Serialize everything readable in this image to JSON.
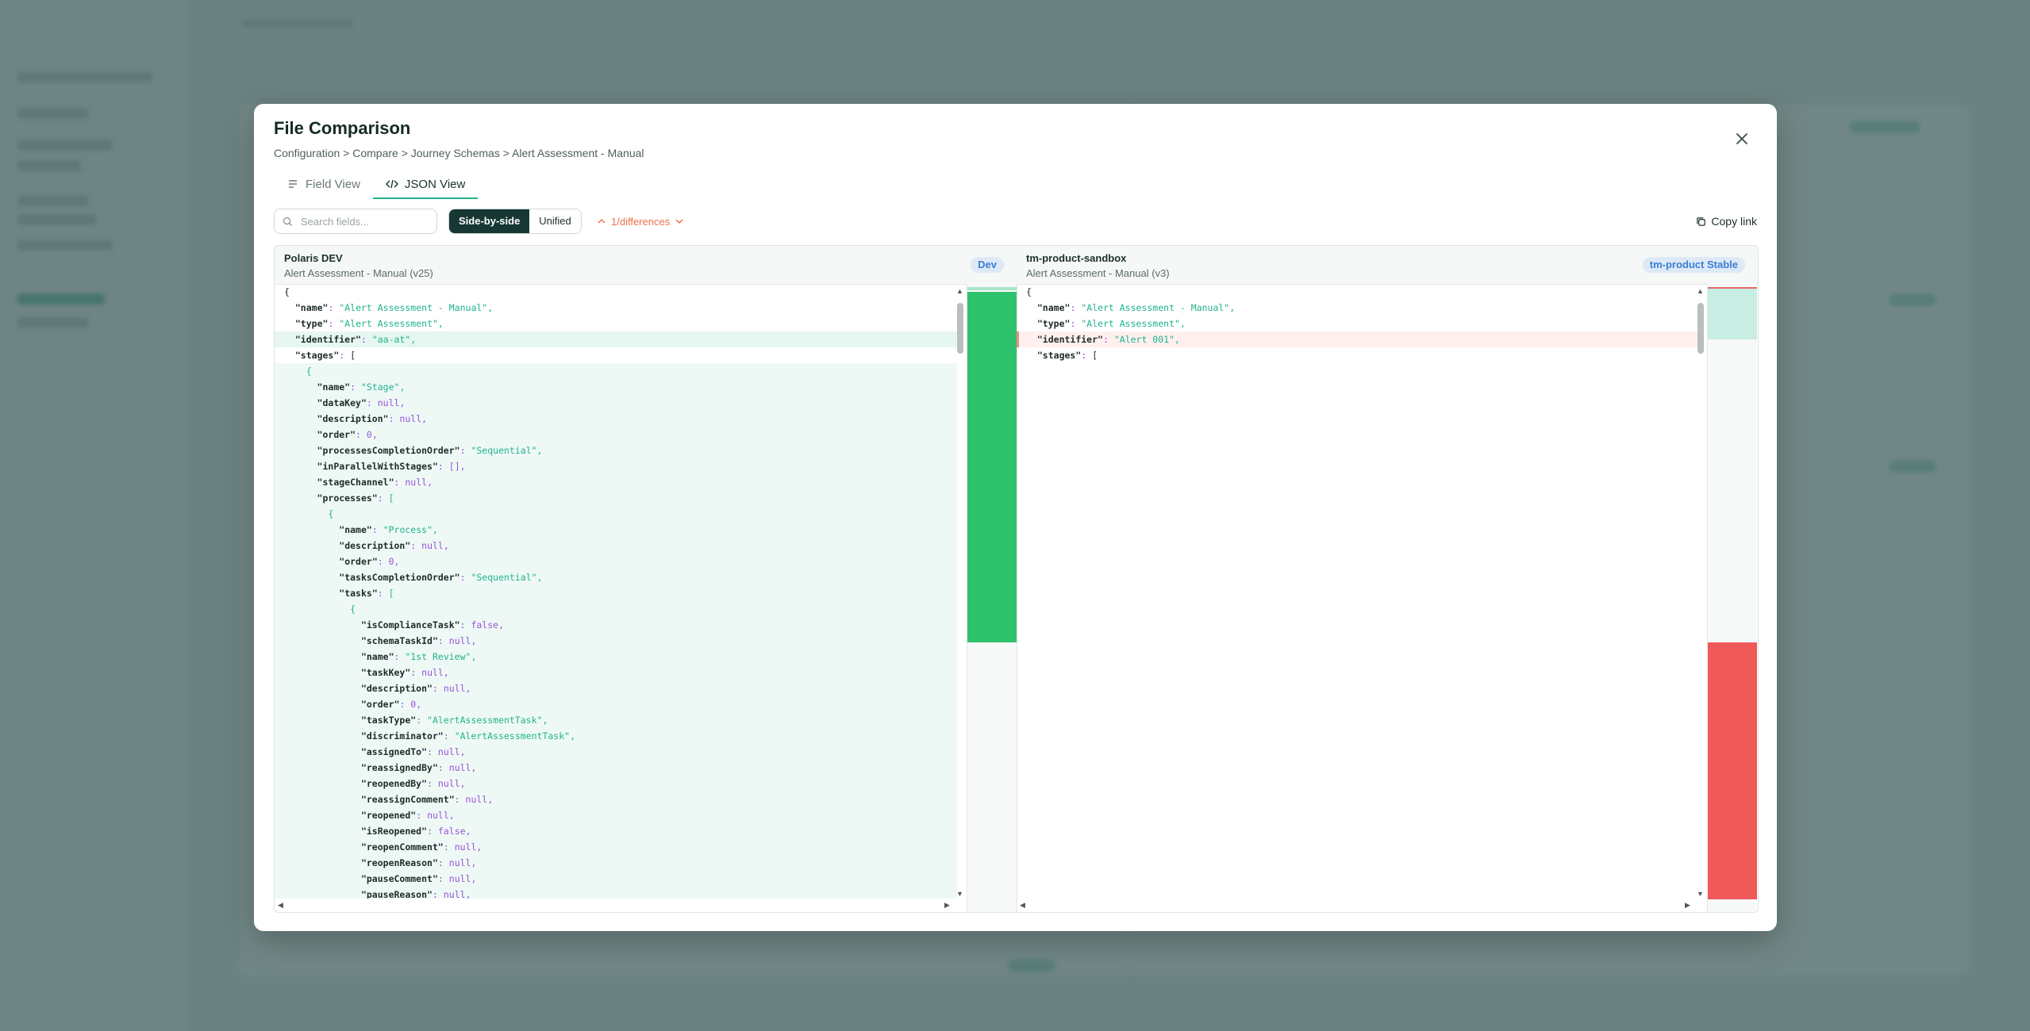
{
  "modal": {
    "title": "File Comparison",
    "breadcrumb": "Configuration > Compare > Journey Schemas > Alert Assessment - Manual",
    "tabs": [
      {
        "label": "Field View",
        "icon": "list-icon",
        "active": false
      },
      {
        "label": "JSON View",
        "icon": "code-icon",
        "active": true
      }
    ]
  },
  "toolbar": {
    "search_placeholder": "Search fields...",
    "view_modes": [
      "Side-by-side",
      "Unified"
    ],
    "active_view_mode": "Side-by-side",
    "differences_label": "1/differences",
    "copy_link_label": "Copy link"
  },
  "left_panel": {
    "env_name": "Polaris DEV",
    "schema_name": "Alert Assessment - Manual (v25)",
    "badge": "Dev"
  },
  "right_panel": {
    "env_name": "tm-product-sandbox",
    "schema_name": "Alert Assessment - Manual (v3)",
    "badge": "tm-product Stable"
  },
  "left_lines": [
    {
      "indent": 0,
      "text": "{",
      "status": "normal"
    },
    {
      "indent": 1,
      "key": "name",
      "value": "\"Alert Assessment - Manual\"",
      "vtype": "s",
      "status": "normal"
    },
    {
      "indent": 1,
      "key": "type",
      "value": "\"Alert Assessment\"",
      "vtype": "s",
      "status": "normal"
    },
    {
      "indent": 1,
      "key": "identifier",
      "value": "\"aa-at\"",
      "vtype": "s",
      "status": "changed"
    },
    {
      "indent": 1,
      "key": "stages",
      "value": "[",
      "vtype": "p",
      "status": "normal"
    },
    {
      "indent": 2,
      "text": "{",
      "status": "added"
    },
    {
      "indent": 3,
      "key": "name",
      "value": "\"Stage\"",
      "vtype": "s",
      "status": "added"
    },
    {
      "indent": 3,
      "key": "dataKey",
      "value": "null",
      "vtype": "n",
      "status": "added"
    },
    {
      "indent": 3,
      "key": "description",
      "value": "null",
      "vtype": "n",
      "status": "added"
    },
    {
      "indent": 3,
      "key": "order",
      "value": "0",
      "vtype": "n",
      "status": "added"
    },
    {
      "indent": 3,
      "key": "processesCompletionOrder",
      "value": "\"Sequential\"",
      "vtype": "s",
      "status": "added"
    },
    {
      "indent": 3,
      "key": "inParallelWithStages",
      "value": "[]",
      "vtype": "n",
      "status": "added"
    },
    {
      "indent": 3,
      "key": "stageChannel",
      "value": "null",
      "vtype": "n",
      "status": "added"
    },
    {
      "indent": 3,
      "key": "processes",
      "value": "[",
      "vtype": "s",
      "status": "added"
    },
    {
      "indent": 4,
      "text": "{",
      "status": "added"
    },
    {
      "indent": 5,
      "key": "name",
      "value": "\"Process\"",
      "vtype": "s",
      "status": "added"
    },
    {
      "indent": 5,
      "key": "description",
      "value": "null",
      "vtype": "n",
      "status": "added"
    },
    {
      "indent": 5,
      "key": "order",
      "value": "0",
      "vtype": "n",
      "status": "added"
    },
    {
      "indent": 5,
      "key": "tasksCompletionOrder",
      "value": "\"Sequential\"",
      "vtype": "s",
      "status": "added"
    },
    {
      "indent": 5,
      "key": "tasks",
      "value": "[",
      "vtype": "s",
      "status": "added"
    },
    {
      "indent": 6,
      "text": "{",
      "status": "added"
    },
    {
      "indent": 7,
      "key": "isComplianceTask",
      "value": "false",
      "vtype": "n",
      "status": "added"
    },
    {
      "indent": 7,
      "key": "schemaTaskId",
      "value": "null",
      "vtype": "n",
      "status": "added"
    },
    {
      "indent": 7,
      "key": "name",
      "value": "\"1st Review\"",
      "vtype": "s",
      "status": "added"
    },
    {
      "indent": 7,
      "key": "taskKey",
      "value": "null",
      "vtype": "n",
      "status": "added"
    },
    {
      "indent": 7,
      "key": "description",
      "value": "null",
      "vtype": "n",
      "status": "added"
    },
    {
      "indent": 7,
      "key": "order",
      "value": "0",
      "vtype": "n",
      "status": "added"
    },
    {
      "indent": 7,
      "key": "taskType",
      "value": "\"AlertAssessmentTask\"",
      "vtype": "s",
      "status": "added"
    },
    {
      "indent": 7,
      "key": "discriminator",
      "value": "\"AlertAssessmentTask\"",
      "vtype": "s",
      "status": "added"
    },
    {
      "indent": 7,
      "key": "assignedTo",
      "value": "null",
      "vtype": "n",
      "status": "added"
    },
    {
      "indent": 7,
      "key": "reassignedBy",
      "value": "null",
      "vtype": "n",
      "status": "added"
    },
    {
      "indent": 7,
      "key": "reopenedBy",
      "value": "null",
      "vtype": "n",
      "status": "added"
    },
    {
      "indent": 7,
      "key": "reassignComment",
      "value": "null",
      "vtype": "n",
      "status": "added"
    },
    {
      "indent": 7,
      "key": "reopened",
      "value": "null",
      "vtype": "n",
      "status": "added"
    },
    {
      "indent": 7,
      "key": "isReopened",
      "value": "false",
      "vtype": "n",
      "status": "added"
    },
    {
      "indent": 7,
      "key": "reopenComment",
      "value": "null",
      "vtype": "n",
      "status": "added"
    },
    {
      "indent": 7,
      "key": "reopenReason",
      "value": "null",
      "vtype": "n",
      "status": "added"
    },
    {
      "indent": 7,
      "key": "pauseComment",
      "value": "null",
      "vtype": "n",
      "status": "added"
    },
    {
      "indent": 7,
      "key": "pauseReason",
      "value": "null",
      "vtype": "n",
      "status": "added"
    }
  ],
  "right_lines": [
    {
      "indent": 0,
      "text": "{",
      "status": "normal"
    },
    {
      "indent": 1,
      "key": "name",
      "value": "\"Alert Assessment - Manual\"",
      "vtype": "s",
      "status": "normal"
    },
    {
      "indent": 1,
      "key": "type",
      "value": "\"Alert Assessment\"",
      "vtype": "s",
      "status": "normal"
    },
    {
      "indent": 1,
      "key": "identifier",
      "value": "\"Alert 001\"",
      "vtype": "s",
      "status": "removed"
    },
    {
      "indent": 1,
      "key": "stages",
      "value": "[",
      "vtype": "p",
      "status": "normal"
    }
  ],
  "colors": {
    "accent": "#2ab08c",
    "added_minimap": "#2ec26e",
    "removed_minimap": "#ef5a59",
    "badge_blue": "#3c7fd2",
    "diff_orange": "#e9734b"
  }
}
